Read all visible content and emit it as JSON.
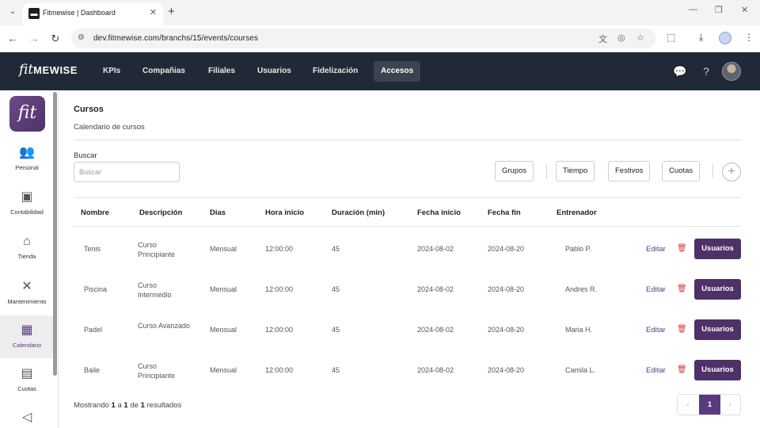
{
  "browser": {
    "tab_title": "Fitmewise | Dashboard",
    "url": "dev.fitmewise.com/branchs/15/events/courses"
  },
  "navbar": {
    "logo_script": "fit",
    "logo_word": "MEWISE",
    "items": [
      {
        "label": "KPIs"
      },
      {
        "label": "Compañias"
      },
      {
        "label": "Filiales"
      },
      {
        "label": "Usuarios"
      },
      {
        "label": "Fidelización"
      },
      {
        "label": "Accesos",
        "active": true
      }
    ]
  },
  "sidebar": {
    "logo_text": "fit",
    "items": [
      {
        "label": "Personal",
        "icon": "people-icon"
      },
      {
        "label": "Contabilidad",
        "icon": "money-icon"
      },
      {
        "label": "Tienda",
        "icon": "store-icon"
      },
      {
        "label": "Mantenimiento",
        "icon": "tools-icon"
      },
      {
        "label": "Calendario",
        "icon": "calendar-icon",
        "active": true
      },
      {
        "label": "Cuotas",
        "icon": "cash-icon"
      }
    ]
  },
  "page": {
    "title": "Cursos",
    "subtitle": "Calendario de cursos",
    "search_label": "Buscar",
    "search_placeholder": "Buscar",
    "filters": [
      "Grupos",
      "Tiempo",
      "Festivos",
      "Cuotas"
    ]
  },
  "table": {
    "headers": [
      "Nombre",
      "Descripción",
      "Dias",
      "Hora inicio",
      "Duración (min)",
      "Fecha inicio",
      "Fecha fin",
      "Entrenador"
    ],
    "edit_label": "Editar",
    "users_label": "Usuarios",
    "rows": [
      {
        "nombre": "Tenis",
        "descripcion": "Curso Principiante",
        "dias": "Mensual",
        "hora": "12:00:00",
        "duracion": "45",
        "inicio": "2024-08-02",
        "fin": "2024-08-20",
        "entrenador": "Pablo P."
      },
      {
        "nombre": "Piscina",
        "descripcion": "Curso Intermedio",
        "dias": "Mensual",
        "hora": "12:00:00",
        "duracion": "45",
        "inicio": "2024-08-02",
        "fin": "2024-08-20",
        "entrenador": "Andres R."
      },
      {
        "nombre": "Padel",
        "descripcion": "Curso Avanzado",
        "dias": "Mensual",
        "hora": "12:00:00",
        "duracion": "45",
        "inicio": "2024-08-02",
        "fin": "2024-08-20",
        "entrenador": "Maria H."
      },
      {
        "nombre": "Baile",
        "descripcion": "Curso Principiante",
        "dias": "Mensual",
        "hora": "12:00:00",
        "duracion": "45",
        "inicio": "2024-08-02",
        "fin": "2024-08-20",
        "entrenador": "Camila L."
      }
    ]
  },
  "footer": {
    "results_prefix": "Mostrando",
    "results_from": "1",
    "results_mid": "a",
    "results_to": "1",
    "results_of": "de",
    "results_total": "1",
    "results_suffix": "resultados",
    "current_page": "1"
  },
  "colors": {
    "navbar_bg": "#222936",
    "accent": "#5a3a7e",
    "button_dark": "#4d3168",
    "danger": "#d33c3c"
  }
}
